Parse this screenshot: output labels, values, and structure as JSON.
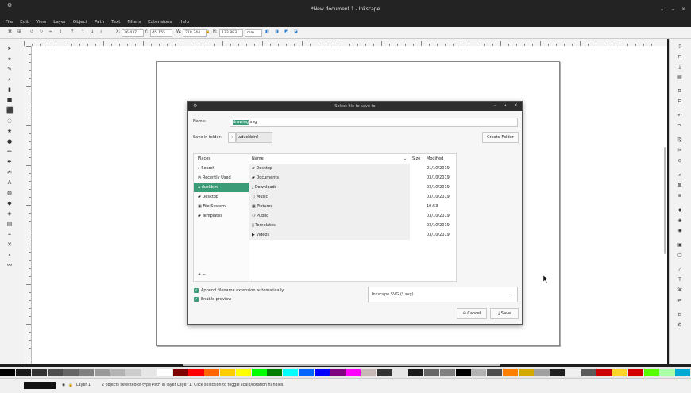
{
  "window": {
    "title": "*New document 1 - Inkscape",
    "controls": [
      "▴",
      "–",
      "×"
    ]
  },
  "menubar": [
    "File",
    "Edit",
    "View",
    "Layer",
    "Object",
    "Path",
    "Text",
    "Filters",
    "Extensions",
    "Help"
  ],
  "toolbar": {
    "x_label": "X:",
    "x_value": "36.437",
    "y_label": "Y:",
    "y_value": "45.155",
    "w_label": "W:",
    "w_value": "218.344",
    "h_label": "H:",
    "h_value": "133.883",
    "unit": "mm"
  },
  "dialog": {
    "title": "Select file to save to",
    "name_label": "Name:",
    "name_selected": "drawing",
    "name_ext": ".svg",
    "save_in_label": "Save in folder:",
    "folder": "duckbird",
    "create_folder": "Create Folder",
    "places_header": "Places",
    "places": [
      {
        "label": "Search",
        "icon": "search-icon"
      },
      {
        "label": "Recently Used",
        "icon": "clock-icon"
      },
      {
        "label": "duckbird",
        "icon": "home-icon",
        "selected": true
      },
      {
        "label": "Desktop",
        "icon": "folder-icon"
      },
      {
        "label": "File System",
        "icon": "drive-icon"
      },
      {
        "label": "Templates",
        "icon": "folder-icon"
      }
    ],
    "columns": {
      "name": "Name",
      "size": "Size",
      "modified": "Modified"
    },
    "files": [
      {
        "name": "Desktop",
        "modified": "21/10/2019",
        "icon": "folder-icon"
      },
      {
        "name": "Documents",
        "modified": "03/10/2019",
        "icon": "folder-icon"
      },
      {
        "name": "Downloads",
        "modified": "03/10/2019",
        "icon": "download-icon"
      },
      {
        "name": "Music",
        "modified": "03/10/2019",
        "icon": "music-icon"
      },
      {
        "name": "Pictures",
        "modified": "10:53",
        "icon": "picture-icon"
      },
      {
        "name": "Public",
        "modified": "03/10/2019",
        "icon": "people-icon"
      },
      {
        "name": "Templates",
        "modified": "03/10/2019",
        "icon": "template-icon"
      },
      {
        "name": "Videos",
        "modified": "03/10/2019",
        "icon": "video-icon"
      }
    ],
    "add_remove": "+ −",
    "append_ext": "Append filename extension automatically",
    "enable_preview": "Enable preview",
    "filter": "Inkscape SVG (*.svg)",
    "cancel": "Cancel",
    "save": "Save"
  },
  "status": {
    "layer": "Layer 1",
    "message": "2 objects selected of type Path in layer Layer 1. Click selection to toggle scale/rotation handles."
  },
  "palette": [
    "#000000",
    "#1a1a1a",
    "#333333",
    "#4d4d4d",
    "#666666",
    "#808080",
    "#999999",
    "#b3b3b3",
    "#cccccc",
    "#e6e6e6",
    "#ffffff",
    "#800000",
    "#ff0000",
    "#ff6600",
    "#ffcc00",
    "#ffff00",
    "#00ff00",
    "#008000",
    "#00ffff",
    "#0066ff",
    "#0000ff",
    "#800080",
    "#ff00ff",
    "#c8b7b7",
    "#333333",
    "#e6e6e6",
    "#1a1a1a",
    "#666666",
    "#808080",
    "#000000",
    "#b3b3b3",
    "#4d4d4d",
    "#ff8000",
    "#d4aa00",
    "#a0a0a0",
    "#202020",
    "#f0f0f0",
    "#5a5a5a",
    "#cc0000",
    "#ffd42a",
    "#d40000",
    "#55ff00",
    "#aaffaa",
    "#00aad4"
  ]
}
